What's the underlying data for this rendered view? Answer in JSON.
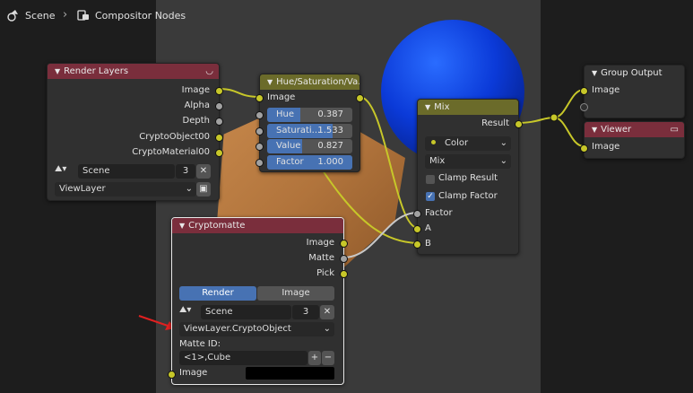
{
  "breadcrumb": {
    "scene": "Scene",
    "separator": "›",
    "editor": "Compositor Nodes"
  },
  "colors": {
    "yellow_socket": "#c7c729",
    "gray_socket": "#a1a1a1",
    "render_header": "#7a2e3c",
    "color_header": "#6b6b2a",
    "accent_blue": "#4772b3"
  },
  "render_layers": {
    "title": "Render Layers",
    "outputs": [
      "Image",
      "Alpha",
      "Depth",
      "CryptoObject00",
      "CryptoMaterial00"
    ],
    "scene_name": "Scene",
    "scene_users": "3",
    "view_layer": "ViewLayer"
  },
  "hue_sat": {
    "title": "Hue/Saturation/Va...",
    "input_label": "Image",
    "sliders": [
      {
        "label": "Hue",
        "value": "0.387",
        "fill": 0.387
      },
      {
        "label": "Saturati...",
        "value": "1.533",
        "fill": 0.77
      },
      {
        "label": "Value",
        "value": "0.827",
        "fill": 0.41
      },
      {
        "label": "Factor",
        "value": "1.000",
        "fill": 1.0
      }
    ]
  },
  "mix": {
    "title": "Mix",
    "output": "Result",
    "data_type": "Color",
    "blend_mode": "Mix",
    "clamp_result": "Clamp Result",
    "clamp_factor": "Clamp Factor",
    "inputs": [
      "Factor",
      "A",
      "B"
    ]
  },
  "group_output": {
    "title": "Group Output",
    "input": "Image"
  },
  "viewer": {
    "title": "Viewer",
    "input": "Image"
  },
  "cryptomatte": {
    "title": "Cryptomatte",
    "outputs": [
      "Image",
      "Matte",
      "Pick"
    ],
    "tab_render": "Render",
    "tab_image": "Image",
    "scene_name": "Scene",
    "scene_users": "3",
    "layer": "ViewLayer.CryptoObject",
    "matte_id_label": "Matte ID:",
    "matte_id": "<1>,Cube",
    "input_image": "Image"
  }
}
